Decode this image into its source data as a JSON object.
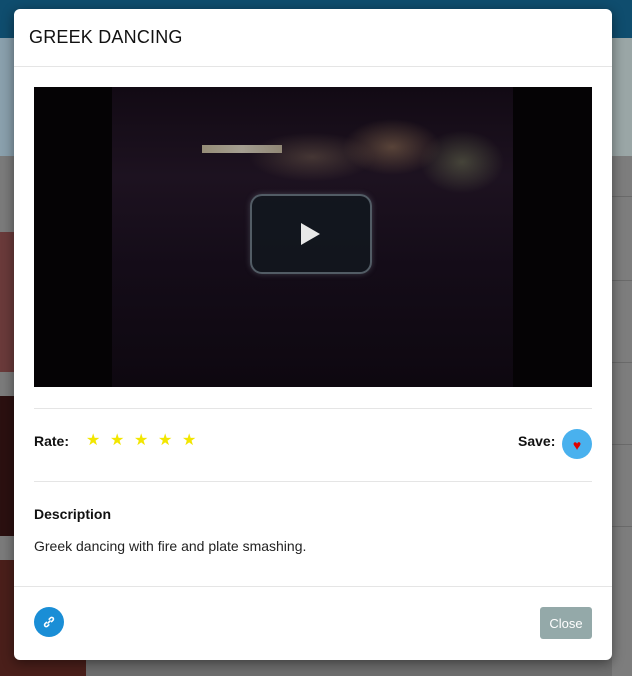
{
  "modal": {
    "title": "GREEK DANCING",
    "rate_label": "Rate:",
    "rating_stars": 5,
    "save_label": "Save:",
    "description_heading": "Description",
    "description_text": "Greek dancing with fire and plate smashing.",
    "close_label": "Close"
  },
  "icons": {
    "play": "play-icon",
    "star": "star-icon",
    "heart": "heart-icon",
    "link": "link-icon"
  },
  "colors": {
    "star": "#f2e600",
    "save_button": "#49b1ee",
    "heart": "#e00000",
    "link_button": "#1a8ed6",
    "close_button": "#94a9a9"
  }
}
